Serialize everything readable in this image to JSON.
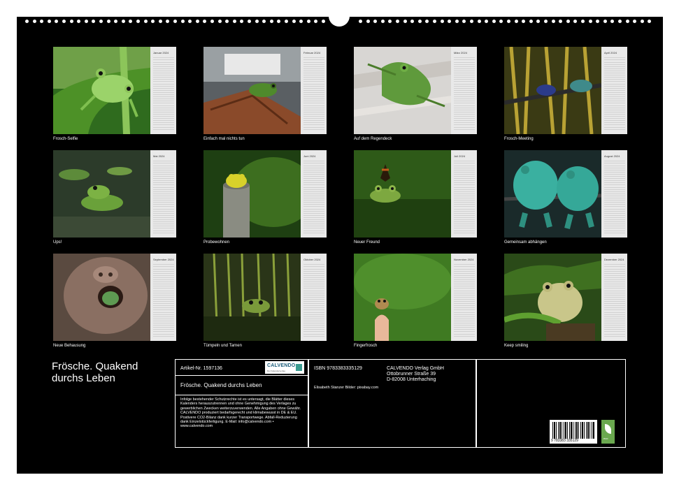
{
  "year": "2024",
  "product_title": "Frösche. Quakend durchs Leben",
  "months": [
    {
      "name": "Januar",
      "caption": "Frosch-Selfie"
    },
    {
      "name": "Februar",
      "caption": "Einfach mal nichts tun"
    },
    {
      "name": "März",
      "caption": "Auf dem Regendeck"
    },
    {
      "name": "April",
      "caption": "Frosch-Meeting"
    },
    {
      "name": "Mai",
      "caption": "Ups!"
    },
    {
      "name": "Juni",
      "caption": "Probewohnen"
    },
    {
      "name": "Juli",
      "caption": "Neuer Freund"
    },
    {
      "name": "August",
      "caption": "Gemeinsam abhängen"
    },
    {
      "name": "September",
      "caption": "Neue Behausung"
    },
    {
      "name": "Oktober",
      "caption": "Tümpeln und Tarnen"
    },
    {
      "name": "November",
      "caption": "Fingerfrosch"
    },
    {
      "name": "Dezember",
      "caption": "Keep smiling"
    }
  ],
  "info": {
    "article": "Artikel-Nr. 1597136",
    "title": "Frösche. Quakend durchs Leben",
    "isbn": "ISBN 9783383335129",
    "publisher_line1": "CALVENDO Verlag GmbH",
    "publisher_line2": "Ottobrunner Straße 39",
    "publisher_line3": "D-82008 Unterhaching",
    "author": "Elisabeth Stanzer Bilder: pixabay.com",
    "disclaimer": "Infolge bestehender Schutzrechte ist es untersagt, die Blätter dieses Kalenders herauszutrennen und ohne Genehmigung des Verlages zu gewerblichen Zwecken weiterzuverwenden. Alle Angaben ohne Gewähr. CALVENDO produziert bedarfsgerecht und klimabewusst in DE & EU. Postivere CO2-Bilanz dank kurzer Transportwege. Abfall-Reduzierung dank Einzelstückfertigung. E-Mail: info@calvendo.com • www.calvendo.com",
    "logo_text": "CALVENDO",
    "logo_sub": "Der Kalenderverlag",
    "barcode_number": "9 783383 335129",
    "eco_label": "eco"
  },
  "colors": {
    "sheet": "#000000",
    "calendar_strip": "#e9e9e9",
    "eco_badge": "#6aa84f",
    "logo_mark": "#3a9b8f"
  },
  "icons": [
    "binding-holes",
    "calvendo-logo",
    "barcode",
    "eco-leaf-icon"
  ]
}
